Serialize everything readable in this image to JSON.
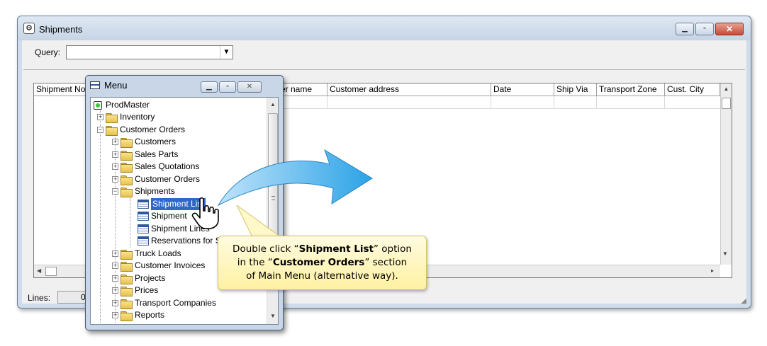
{
  "main_window": {
    "title": "Shipments",
    "query_label": "Query:",
    "query_value": "",
    "columns": [
      "Shipment No",
      "er name",
      "Customer address",
      "Date",
      "Ship Via",
      "Transport Zone",
      "Cust. City"
    ],
    "lines_label": "Lines:",
    "lines_value": "0"
  },
  "menu_window": {
    "title": "Menu",
    "tree": {
      "root": "ProdMaster",
      "inventory": "Inventory",
      "customer_orders": "Customer Orders",
      "customers": "Customers",
      "sales_parts": "Sales Parts",
      "sales_quotations": "Sales Quotations",
      "customer_orders_child": "Customer Orders",
      "shipments": "Shipments",
      "shipment_list": "Shipment List",
      "shipment": "Shipment",
      "shipment_lines": "Shipment Lines",
      "reservations": "Reservations for S",
      "truck_loads": "Truck Loads",
      "customer_invoices": "Customer Invoices",
      "projects": "Projects",
      "prices": "Prices",
      "transport_companies": "Transport Companies",
      "reports": "Reports"
    }
  },
  "callout": {
    "t1": "Double click “",
    "t2": "Shipment List",
    "t3": "” option",
    "t4": "in the “",
    "t5": "Customer Orders",
    "t6": "” section",
    "t7": "of Main Menu (alternative way)."
  },
  "colors": {
    "arrow": "#2ba3e6",
    "selection": "#3068c8",
    "callout_bg": "#fff4b0"
  }
}
